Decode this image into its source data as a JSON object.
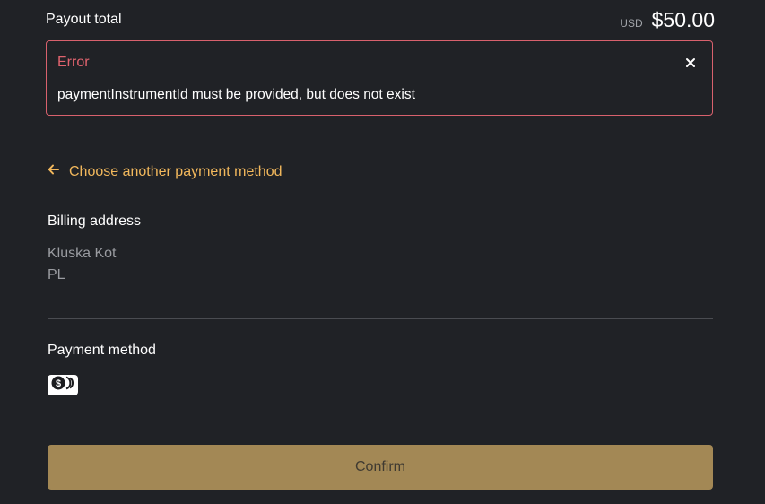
{
  "payout": {
    "label": "Payout total",
    "currency": "USD",
    "amount": "$50.00"
  },
  "error": {
    "title": "Error",
    "message": "paymentInstrumentId must be provided, but does not exist"
  },
  "back_link": {
    "label": "Choose another payment method"
  },
  "billing": {
    "title": "Billing address",
    "lines": [
      "Kluska Kot",
      "PL"
    ]
  },
  "payment_method": {
    "title": "Payment method",
    "icon": "cash-coin-icon"
  },
  "actions": {
    "confirm_label": "Confirm"
  },
  "colors": {
    "background": "#202226",
    "error_border": "#d8616d",
    "error_text": "#e0636e",
    "link": "#f2b85c",
    "muted_text": "#9a9ca1",
    "confirm_button": "#a38855",
    "confirm_text": "#3f3a31"
  }
}
